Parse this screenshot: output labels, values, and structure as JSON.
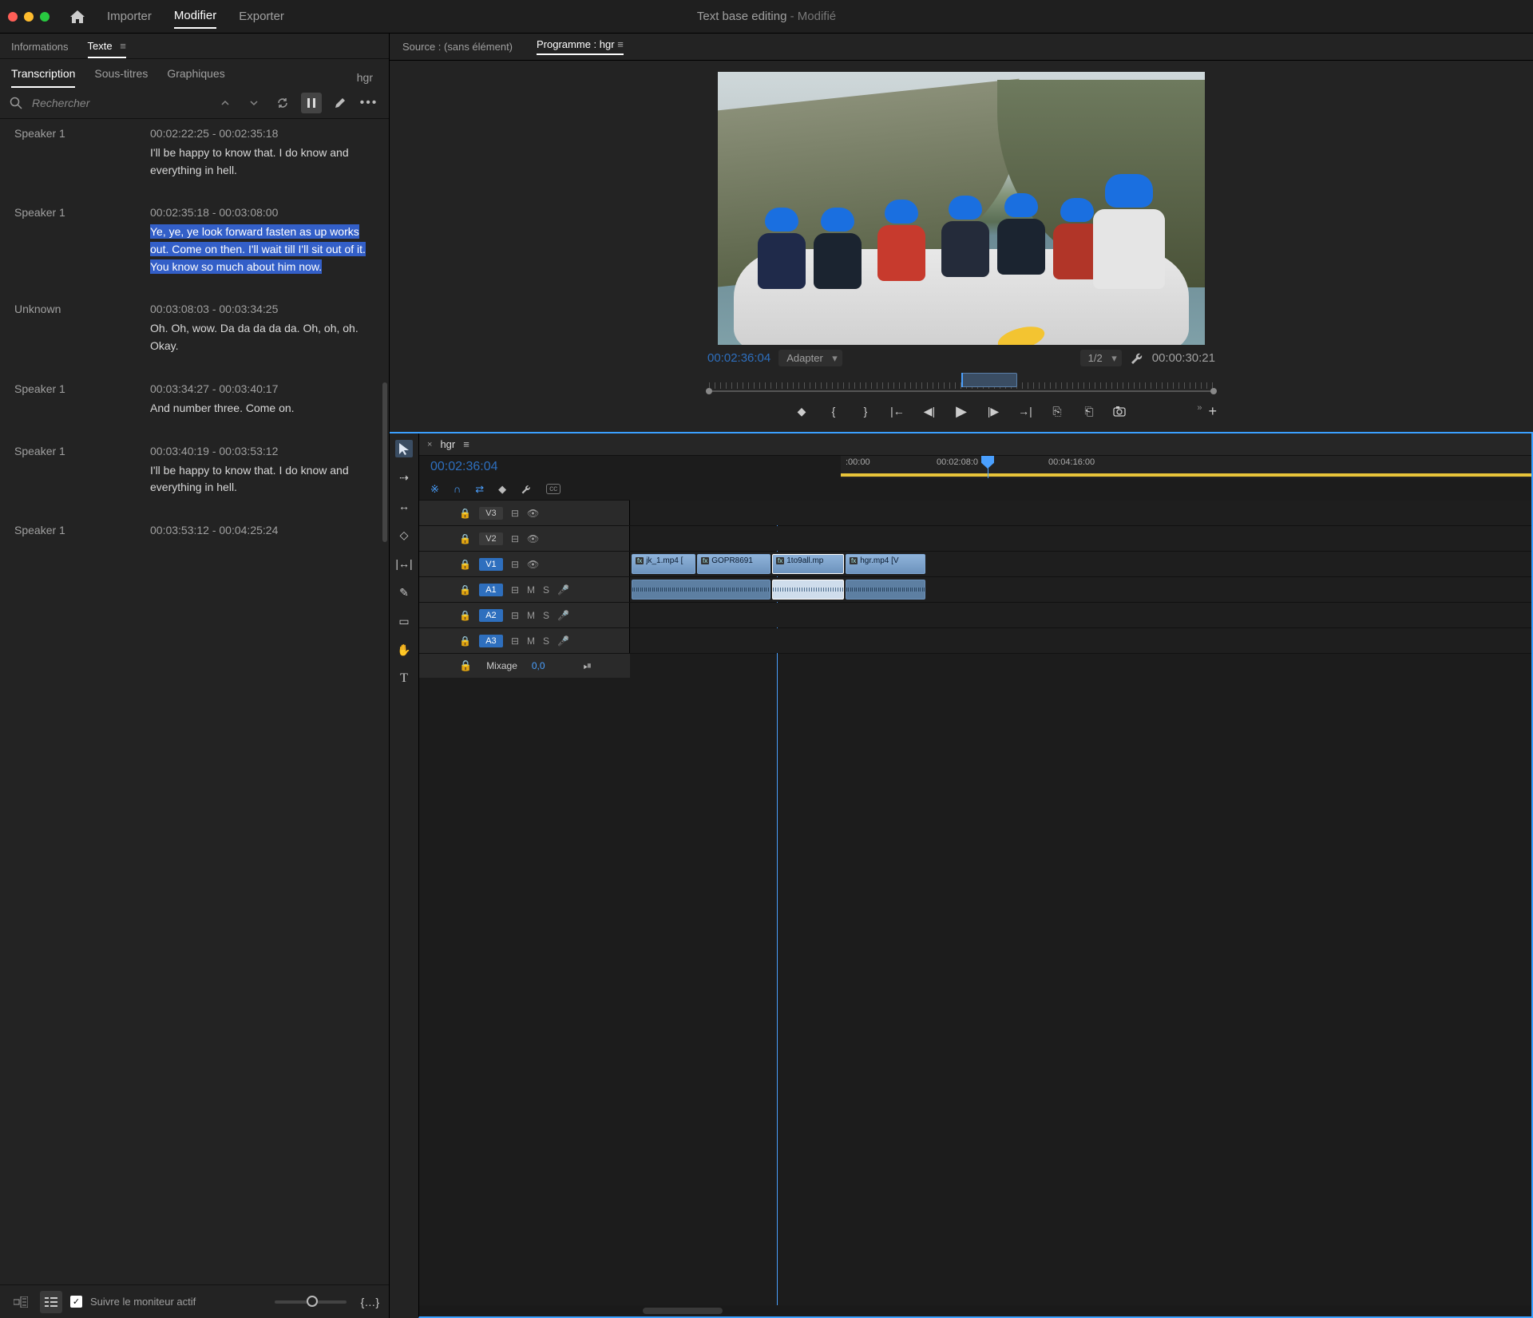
{
  "app": {
    "title": "Text base editing",
    "modified": "- Modifié"
  },
  "top_nav": {
    "home": "home-icon",
    "import": "Importer",
    "modify": "Modifier",
    "export": "Exporter"
  },
  "left_tabs1": {
    "info": "Informations",
    "text": "Texte"
  },
  "left_tabs2": {
    "transcription": "Transcription",
    "subtitles": "Sous-titres",
    "graphics": "Graphiques",
    "seq": "hgr"
  },
  "search": {
    "placeholder": "Rechercher"
  },
  "transcript": [
    {
      "speaker": "Speaker 1",
      "tc": "00:02:22:25 - 00:02:35:18",
      "text": "I'll be happy to know that. I do know and everything in hell.",
      "hl": false
    },
    {
      "speaker": "Speaker 1",
      "tc": "00:02:35:18 - 00:03:08:00",
      "text": "Ye, ye, ye look forward fasten as up works out. Come on then. I'll wait till I'll sit out of it. You know so much about him now.",
      "hl": true
    },
    {
      "speaker": "Unknown",
      "tc": "00:03:08:03 - 00:03:34:25",
      "text": "Oh. Oh, wow. Da da da da da. Oh, oh, oh. Okay.",
      "hl": false
    },
    {
      "speaker": "Speaker 1",
      "tc": "00:03:34:27 - 00:03:40:17",
      "text": "And number three. Come on.",
      "hl": false
    },
    {
      "speaker": "Speaker 1",
      "tc": "00:03:40:19 - 00:03:53:12",
      "text": "I'll be happy to know that. I do know and everything in hell.",
      "hl": false
    },
    {
      "speaker": "Speaker 1",
      "tc": "00:03:53:12 - 00:04:25:24",
      "text": "",
      "hl": false
    }
  ],
  "footer": {
    "follow": "Suivre le moniteur actif"
  },
  "right_tabs": {
    "source": "Source : (sans élément)",
    "program": "Programme : hgr"
  },
  "monitor": {
    "tc_left": "00:02:36:04",
    "fit": "Adapter",
    "res": "1/2",
    "tc_right": "00:00:30:21"
  },
  "timeline": {
    "title": "hgr",
    "tc": "00:02:36:04",
    "ruler": {
      "t0": ":00:00",
      "t1": "00:02:08:0",
      "t2": "00:04:16:00"
    },
    "tracks": {
      "v3": "V3",
      "v2": "V2",
      "v1": "V1",
      "a1": "A1",
      "a2": "A2",
      "a3": "A3",
      "m": "M",
      "s": "S"
    },
    "clips": {
      "c1": "jk_1.mp4 [",
      "c2": "GOPR8691",
      "c3": "1to9all.mp",
      "c4": "hgr.mp4 [V"
    },
    "mix": {
      "label": "Mixage",
      "value": "0,0"
    }
  }
}
